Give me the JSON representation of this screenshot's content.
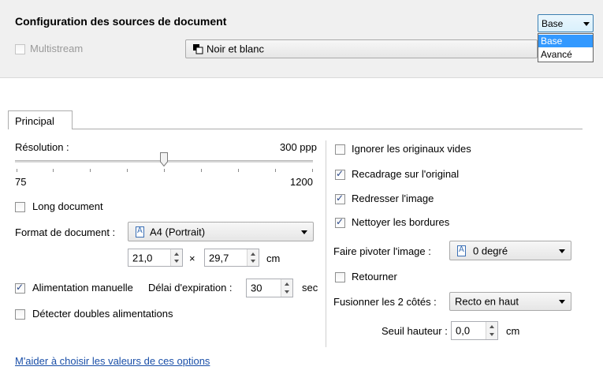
{
  "header": {
    "title": "Configuration des sources de document",
    "mode_select": {
      "value": "Base",
      "options": [
        "Base",
        "Avancé"
      ],
      "highlighted": "Base"
    }
  },
  "source": {
    "multistream_label": "Multistream",
    "multistream_checked": false,
    "color_mode": "Noir et blanc"
  },
  "tabs": [
    {
      "label": "Principal",
      "active": true
    }
  ],
  "left": {
    "resolution_label": "Résolution :",
    "resolution_value": "300 ppp",
    "resolution_min": "75",
    "resolution_max": "1200",
    "long_document_label": "Long document",
    "long_document_checked": false,
    "format_label": "Format de document :",
    "format_value": "A4 (Portrait)",
    "width_value": "21,0",
    "times": "×",
    "height_value": "29,7",
    "size_unit": "cm",
    "manual_feed_label": "Alimentation manuelle",
    "manual_feed_checked": true,
    "timeout_label": "Délai d'expiration :",
    "timeout_value": "30",
    "timeout_unit": "sec",
    "double_feed_label": "Détecter doubles alimentations",
    "double_feed_checked": false
  },
  "right": {
    "ignore_blank_label": "Ignorer les originaux vides",
    "ignore_blank_checked": false,
    "crop_label": "Recadrage sur l'original",
    "crop_checked": true,
    "deskew_label": "Redresser l'image",
    "deskew_checked": true,
    "clean_borders_label": "Nettoyer les bordures",
    "clean_borders_checked": true,
    "rotate_label": "Faire pivoter l'image :",
    "rotate_value": "0 degré",
    "flip_label": "Retourner",
    "flip_checked": false,
    "merge_label": "Fusionner les 2 côtés :",
    "merge_value": "Recto en haut",
    "threshold_label": "Seuil hauteur :",
    "threshold_value": "0,0",
    "threshold_unit": "cm"
  },
  "help_link": "M'aider à choisir les valeurs de ces options"
}
